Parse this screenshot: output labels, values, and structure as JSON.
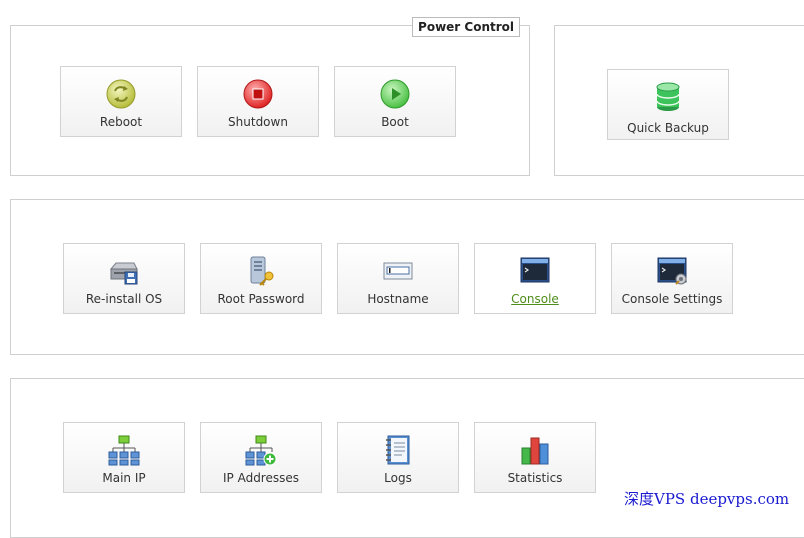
{
  "power_panel": {
    "legend": "Power Control",
    "reboot_label": "Reboot",
    "shutdown_label": "Shutdown",
    "boot_label": "Boot"
  },
  "backup_panel": {
    "quick_backup_label": "Quick Backup"
  },
  "system_panel": {
    "reinstall_label": "Re-install OS",
    "root_password_label": "Root Password",
    "hostname_label": "Hostname",
    "console_label": "Console",
    "console_settings_label": "Console Settings"
  },
  "network_panel": {
    "main_ip_label": "Main IP",
    "ip_addresses_label": "IP Addresses",
    "logs_label": "Logs",
    "statistics_label": "Statistics"
  },
  "watermark": "深度VPS deepvps.com",
  "icons": {
    "reboot": "reboot-icon",
    "shutdown": "shutdown-icon",
    "boot": "boot-icon",
    "quick_backup": "database-icon",
    "reinstall": "reinstall-os-icon",
    "root_password": "key-server-icon",
    "hostname": "hostname-icon",
    "console": "console-icon",
    "console_settings": "console-settings-icon",
    "main_ip": "network-tree-icon",
    "ip_addresses": "network-add-icon",
    "logs": "notebook-icon",
    "statistics": "bar-chart-icon"
  },
  "colors": {
    "link": "#4f8d1c",
    "panel_border": "#cfcfcf"
  }
}
